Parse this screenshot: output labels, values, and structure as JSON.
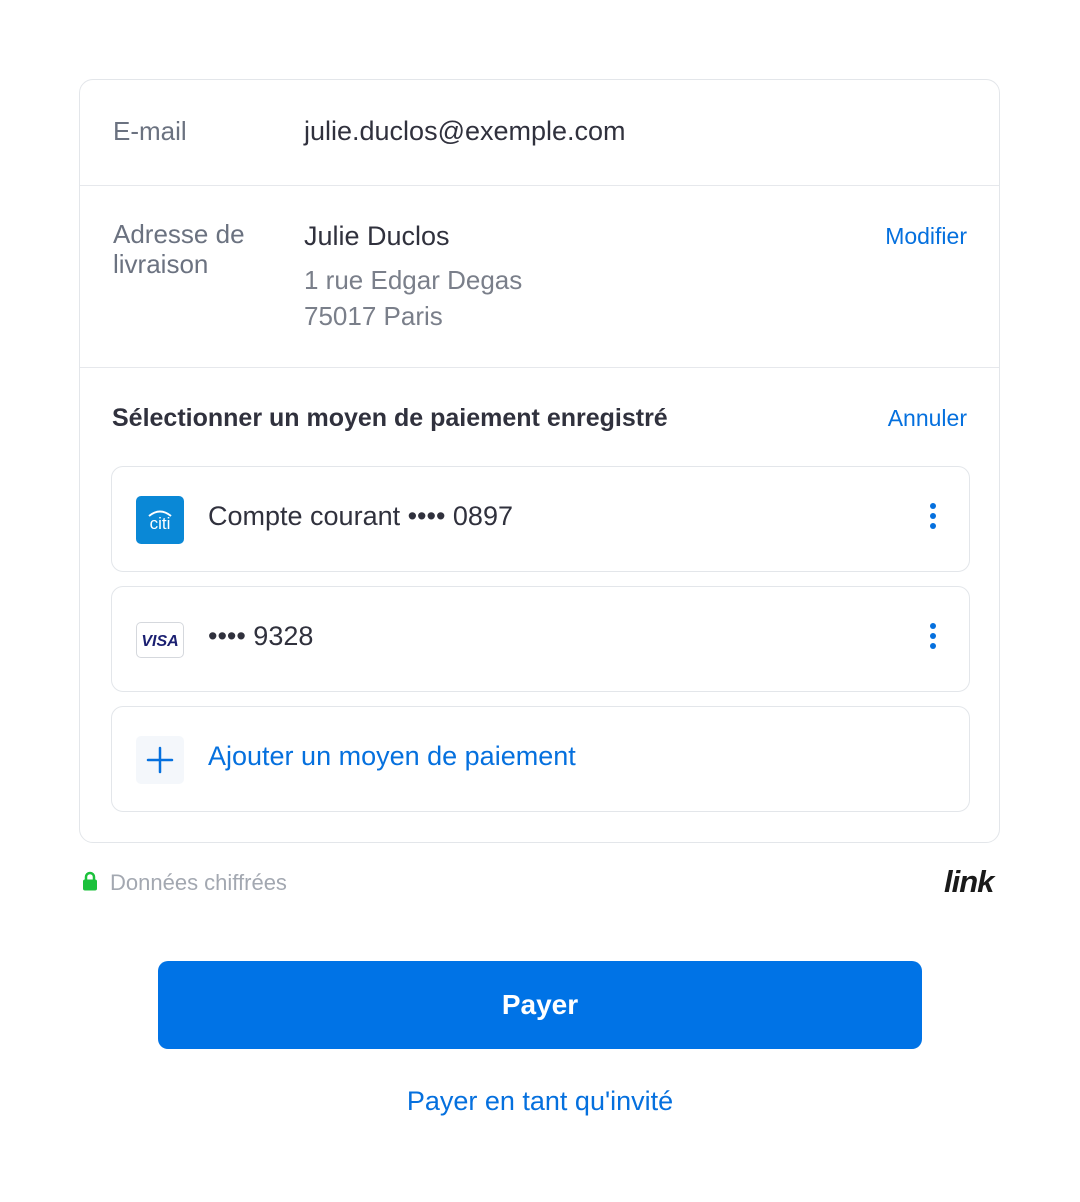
{
  "email": {
    "label": "E-mail",
    "value": "julie.duclos@exemple.com"
  },
  "shipping": {
    "label": "Adresse de livraison",
    "name": "Julie Duclos",
    "line1": "1 rue Edgar Degas",
    "line2": "75017 Paris",
    "edit_label": "Modifier"
  },
  "payment": {
    "title": "Sélectionner un moyen de paiement enregistré",
    "cancel_label": "Annuler",
    "methods": [
      {
        "label": "Compte courant •••• 0897",
        "icon": "citi-bank-icon",
        "brand_text": "citi",
        "brand_color": "#0a88d6"
      },
      {
        "label": "•••• 9328",
        "icon": "visa-card-icon",
        "brand_text": "VISA",
        "brand_color": "#1a1f71"
      }
    ],
    "add_label": "Ajouter un moyen de paiement"
  },
  "footer": {
    "secure_text": "Données chiffrées",
    "logo_text": "link"
  },
  "pay_button": "Payer",
  "guest_link": "Payer en tant qu'invité",
  "colors": {
    "accent": "#0570de",
    "button": "#0073e6",
    "lock": "#1bc13b"
  }
}
